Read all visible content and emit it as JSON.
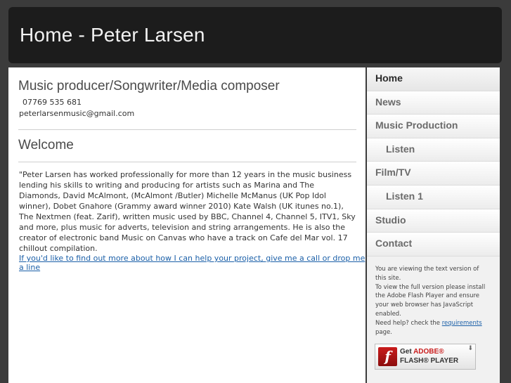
{
  "header": {
    "title": "Home - Peter Larsen"
  },
  "main": {
    "heading": "Music producer/Songwriter/Media composer",
    "phone": "07769 535 681",
    "email": "peterlarsenmusic@gmail.com",
    "welcome_heading": "Welcome",
    "bio": "\"Peter Larsen has worked professionally for more than 12 years in the music business lending his skills to writing and producing for artists such as Marina and The Diamonds, David McAlmont, (McAlmont /Butler) Michelle McManus (UK Pop Idol winner), Dobet Gnahore (Grammy award winner 2010) Kate Walsh (UK itunes no.1), The Nextmen (feat. Zarif), written music used by BBC, Channel 4, Channel 5, ITV1, Sky and more, plus music for adverts, television and string arrangements. He is also the creator of electronic band Music on Canvas who have a track on Cafe del Mar vol. 17 chillout compilation.",
    "contact_link": "If you'd like to find out more about how I can help your project, give me a call or drop me a line"
  },
  "nav": {
    "items": [
      {
        "label": "Home"
      },
      {
        "label": "News"
      },
      {
        "label": "Music Production"
      },
      {
        "label": "Listen"
      },
      {
        "label": "Film/TV"
      },
      {
        "label": "Listen 1"
      },
      {
        "label": "Studio"
      },
      {
        "label": "Contact"
      }
    ]
  },
  "notice": {
    "line1": "You are viewing the text version of this site.",
    "line2": "To view the full version please install the Adobe Flash Player and ensure your web browser has JavaScript enabled.",
    "line3_prefix": "Need help? check the ",
    "line3_link": "requirements",
    "line3_suffix": " page."
  },
  "flash_badge": {
    "line1_prefix": "Get ",
    "line1_brand": "ADOBE®",
    "line2": "FLASH® PLAYER",
    "icon_glyph": "f",
    "arrow_glyph": "⬇",
    "brand_color": "#c91c1c"
  },
  "colors": {
    "background": "#3b3b3b",
    "header_bg": "#1c1c1c",
    "link": "#1a5fa8"
  }
}
